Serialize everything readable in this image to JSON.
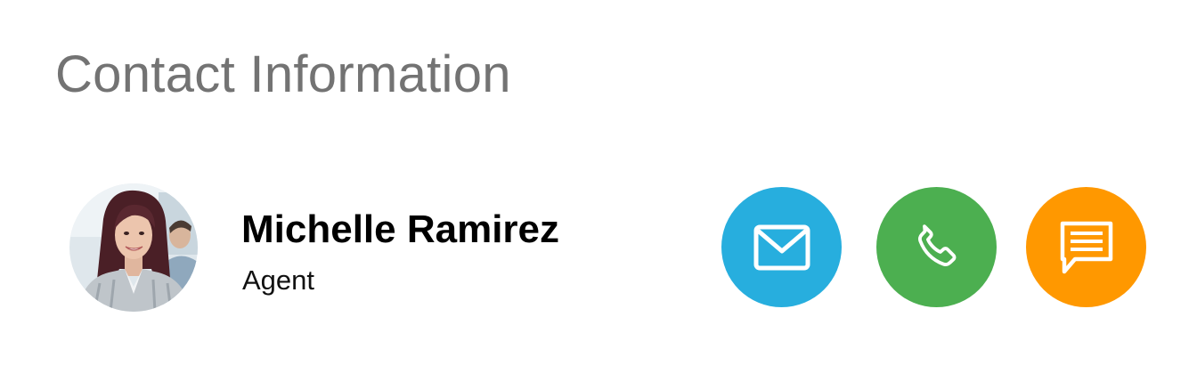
{
  "page": {
    "title": "Contact Information"
  },
  "contact": {
    "name": "Michelle Ramirez",
    "role": "Agent",
    "avatar_alt": "Michelle Ramirez"
  },
  "actions": [
    {
      "id": "email",
      "label": "Email",
      "icon": "envelope-icon",
      "color": "#27AEDE"
    },
    {
      "id": "phone",
      "label": "Call",
      "icon": "phone-icon",
      "color": "#4CAF50"
    },
    {
      "id": "chat",
      "label": "Message",
      "icon": "chat-icon",
      "color": "#FF9800"
    }
  ],
  "colors": {
    "title": "#737373",
    "name": "#000000",
    "role": "#111111",
    "background": "#FFFFFF"
  }
}
